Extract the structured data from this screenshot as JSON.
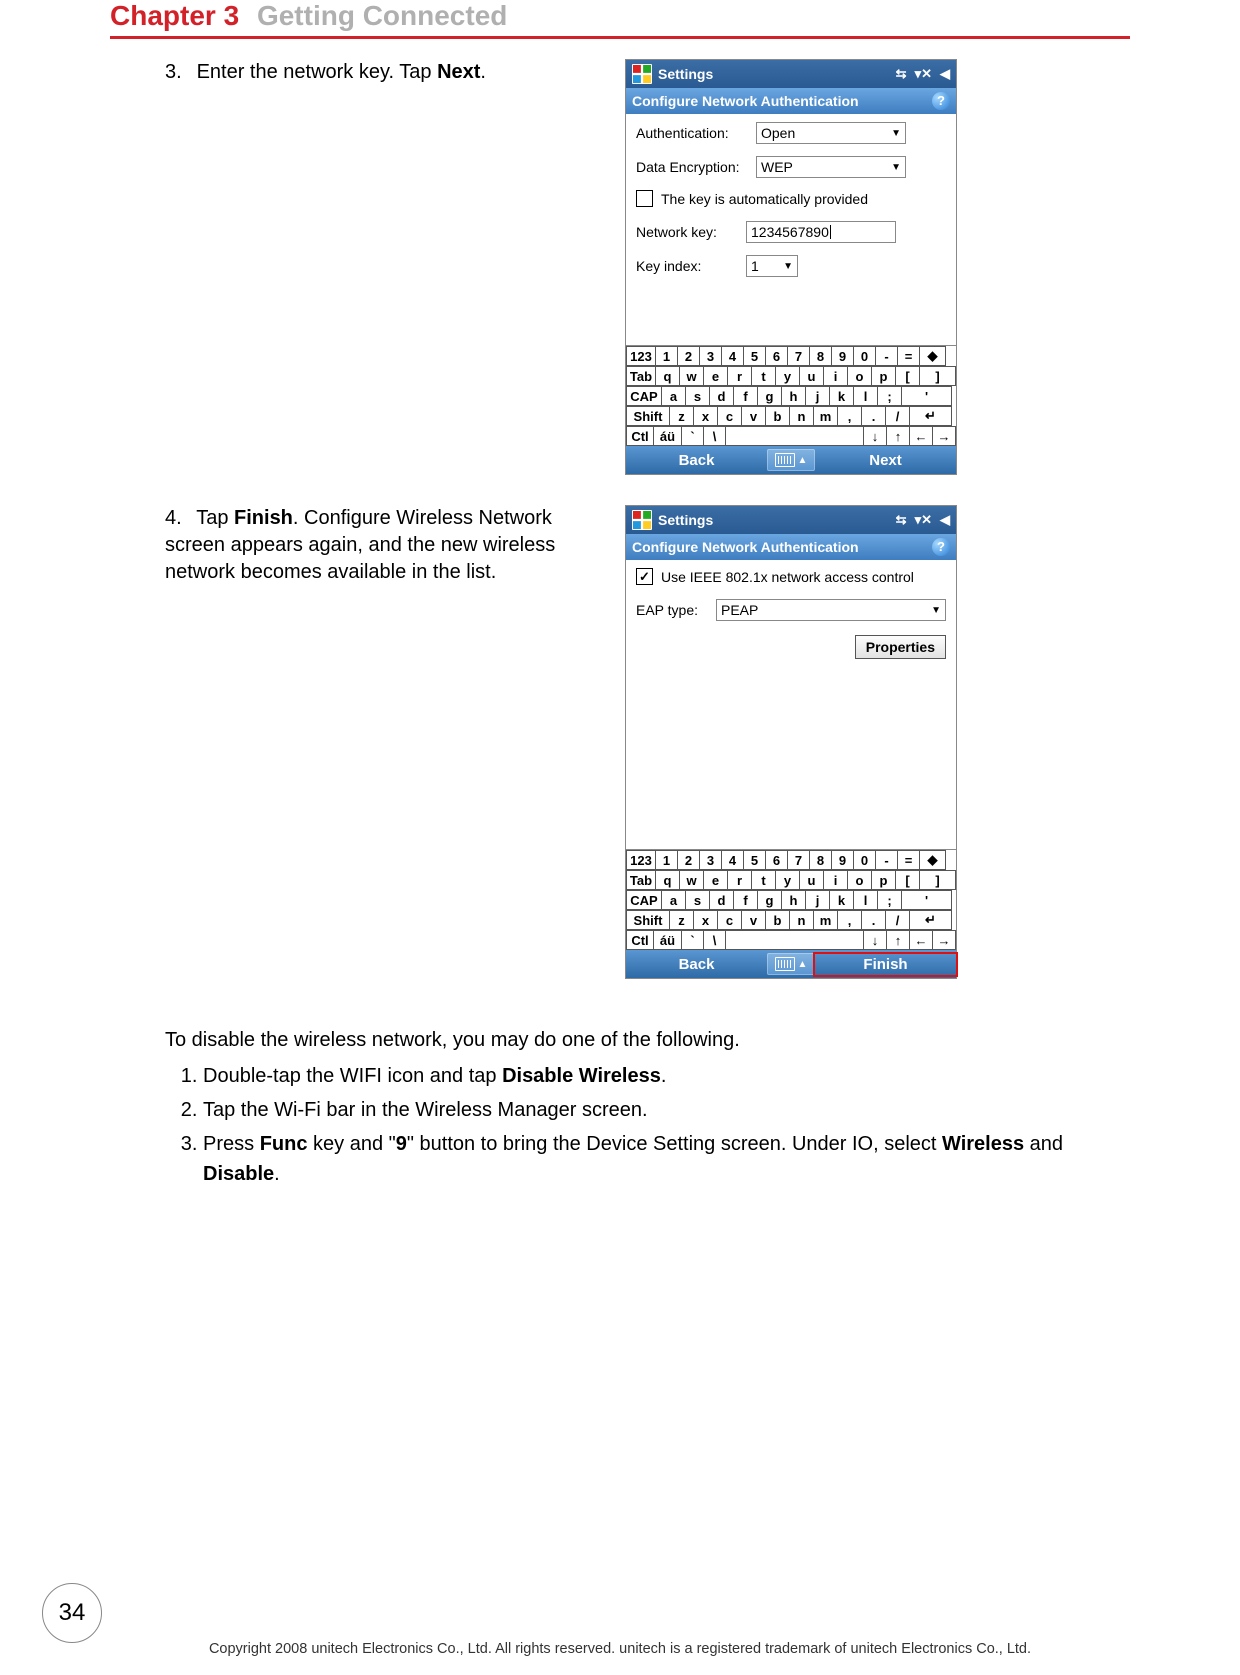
{
  "chapter": {
    "num": "Chapter 3",
    "title": "Getting Connected"
  },
  "step3": {
    "num": "3.",
    "text_before_bold": "Enter the network key. Tap ",
    "bold": "Next",
    "text_after": "."
  },
  "screen1": {
    "title": "Settings",
    "subheader": "Configure Network Authentication",
    "auth_label": "Authentication:",
    "auth_value": "Open",
    "enc_label": "Data Encryption:",
    "enc_value": "WEP",
    "auto_key_label": "The key is automatically provided",
    "nk_label": "Network key:",
    "nk_value": "1234567890",
    "ki_label": "Key index:",
    "ki_value": "1",
    "back": "Back",
    "next": "Next"
  },
  "step4": {
    "num": "4.",
    "parts": [
      {
        "t": "Tap "
      },
      {
        "b": "Finish"
      },
      {
        "t": ". Configure Wireless Network screen appears again, and the new wireless network becomes available in the list."
      }
    ]
  },
  "screen2": {
    "title": "Settings",
    "subheader": "Configure Network Authentication",
    "ieee_label": "Use IEEE 802.1x network access control",
    "eap_label": "EAP type:",
    "eap_value": "PEAP",
    "properties": "Properties",
    "back": "Back",
    "finish": "Finish"
  },
  "kb": {
    "r1": [
      "123",
      "1",
      "2",
      "3",
      "4",
      "5",
      "6",
      "7",
      "8",
      "9",
      "0",
      "-",
      "=",
      "◆"
    ],
    "r2": [
      "Tab",
      "q",
      "w",
      "e",
      "r",
      "t",
      "y",
      "u",
      "i",
      "o",
      "p",
      "[",
      "]"
    ],
    "r3": [
      "CAP",
      "a",
      "s",
      "d",
      "f",
      "g",
      "h",
      "j",
      "k",
      "l",
      ";",
      "'"
    ],
    "r4": [
      "Shift",
      "z",
      "x",
      "c",
      "v",
      "b",
      "n",
      "m",
      ",",
      ".",
      "/",
      "↵"
    ],
    "r5": [
      "Ctl",
      "áü",
      "`",
      "\\",
      " ",
      "↓",
      "↑",
      "←",
      "→"
    ]
  },
  "disable_intro": "To disable the wireless network, you may do one of the following.",
  "disable_items": [
    [
      {
        "t": "Double-tap the WIFI icon and tap "
      },
      {
        "b": "Disable Wireless"
      },
      {
        "t": "."
      }
    ],
    [
      {
        "t": "Tap the Wi-Fi bar in the Wireless Manager screen."
      }
    ],
    [
      {
        "t": "Press "
      },
      {
        "b": "Func"
      },
      {
        "t": " key and \""
      },
      {
        "b": "9"
      },
      {
        "t": "\" button to bring the Device Setting screen. Under IO, select "
      },
      {
        "b": "Wireless"
      },
      {
        "t": " and "
      },
      {
        "b": "Disable"
      },
      {
        "t": "."
      }
    ]
  ],
  "page_number": "34",
  "copyright": "Copyright 2008 unitech Electronics Co., Ltd. All rights reserved. unitech is a registered trademark of unitech Electronics Co., Ltd."
}
